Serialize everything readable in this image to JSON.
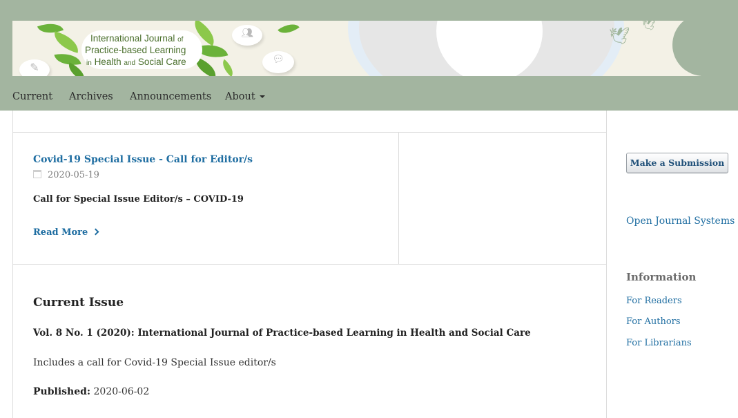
{
  "header": {
    "logo": {
      "line1": "International Journal",
      "line1_small": "of",
      "line2": "Practice-based Learning",
      "line3_small_in": "in",
      "line3_a": "Health",
      "line3_small_and": "and",
      "line3_b": "Social Care"
    },
    "colors": {
      "header_bg": "#a3b5a0",
      "link": "#1e6da1",
      "leaf_green": "#6bb23a"
    }
  },
  "nav": {
    "items": [
      {
        "label": "Current"
      },
      {
        "label": "Archives"
      },
      {
        "label": "Announcements"
      },
      {
        "label": "About",
        "has_dropdown": true
      }
    ]
  },
  "announcement": {
    "title": "Covid-19 Special Issue - Call for Editor/s",
    "date": "2020-05-19",
    "summary": "Call for Special Issue Editor/s – COVID-19",
    "read_more": "Read More"
  },
  "current_issue": {
    "heading": "Current Issue",
    "issue_title": "Vol. 8 No. 1 (2020): International Journal of Practice-based Learning in Health and Social Care",
    "description": "Includes a call for Covid-19 Special Issue editor/s",
    "published_label": "Published:",
    "published_date": "2020-06-02"
  },
  "sidebar": {
    "submit_button": "Make a Submission",
    "ojs_link": "Open Journal Systems",
    "info_heading": "Information",
    "info_links": [
      {
        "label": "For Readers"
      },
      {
        "label": "For Authors"
      },
      {
        "label": "For Librarians"
      }
    ]
  }
}
